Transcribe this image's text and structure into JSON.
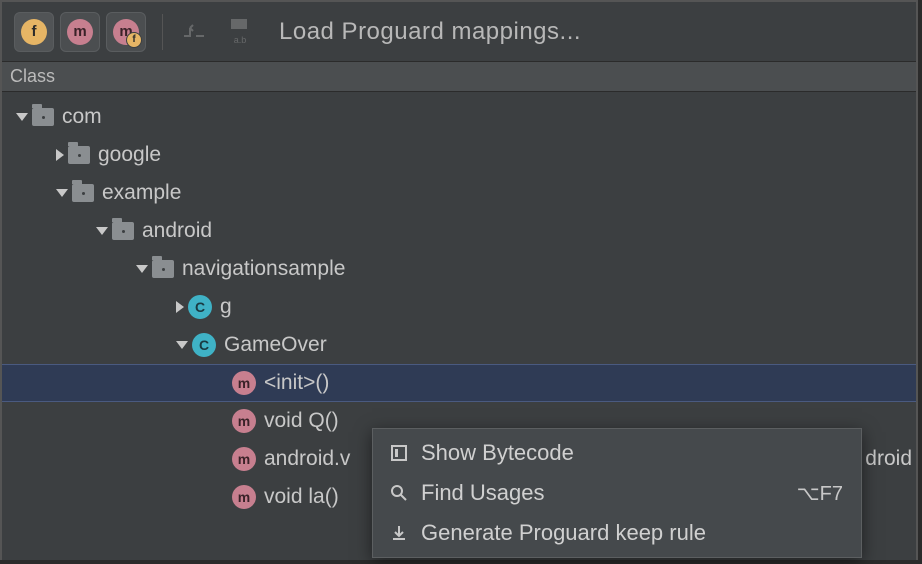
{
  "toolbar": {
    "load_mappings_label": "Load Proguard mappings..."
  },
  "header": {
    "title": "Class"
  },
  "tree": {
    "nodes": [
      {
        "depth": 0,
        "chev": "down",
        "icon": "pkg",
        "label": "com"
      },
      {
        "depth": 1,
        "chev": "right",
        "icon": "pkg",
        "label": "google"
      },
      {
        "depth": 1,
        "chev": "down",
        "icon": "pkg",
        "label": "example"
      },
      {
        "depth": 2,
        "chev": "down",
        "icon": "pkg",
        "label": "android"
      },
      {
        "depth": 3,
        "chev": "down",
        "icon": "pkg",
        "label": "navigationsample"
      },
      {
        "depth": 4,
        "chev": "right",
        "icon": "cls",
        "label": "g"
      },
      {
        "depth": 4,
        "chev": "down",
        "icon": "cls",
        "label": "GameOver"
      },
      {
        "depth": 5,
        "chev": "none",
        "icon": "m",
        "label": "<init>()",
        "selected": true
      },
      {
        "depth": 5,
        "chev": "none",
        "icon": "m",
        "label": "void Q()"
      },
      {
        "depth": 5,
        "chev": "none",
        "icon": "m",
        "label": "android.v",
        "rightclip": "droid"
      },
      {
        "depth": 5,
        "chev": "none",
        "icon": "m",
        "label": "void la()"
      }
    ]
  },
  "context_menu": {
    "items": [
      {
        "icon": "bytecode",
        "label": "Show Bytecode",
        "shortcut": ""
      },
      {
        "icon": "find",
        "label": "Find Usages",
        "shortcut": "⌥F7"
      },
      {
        "icon": "download",
        "label": "Generate Proguard keep rule",
        "shortcut": ""
      }
    ]
  }
}
